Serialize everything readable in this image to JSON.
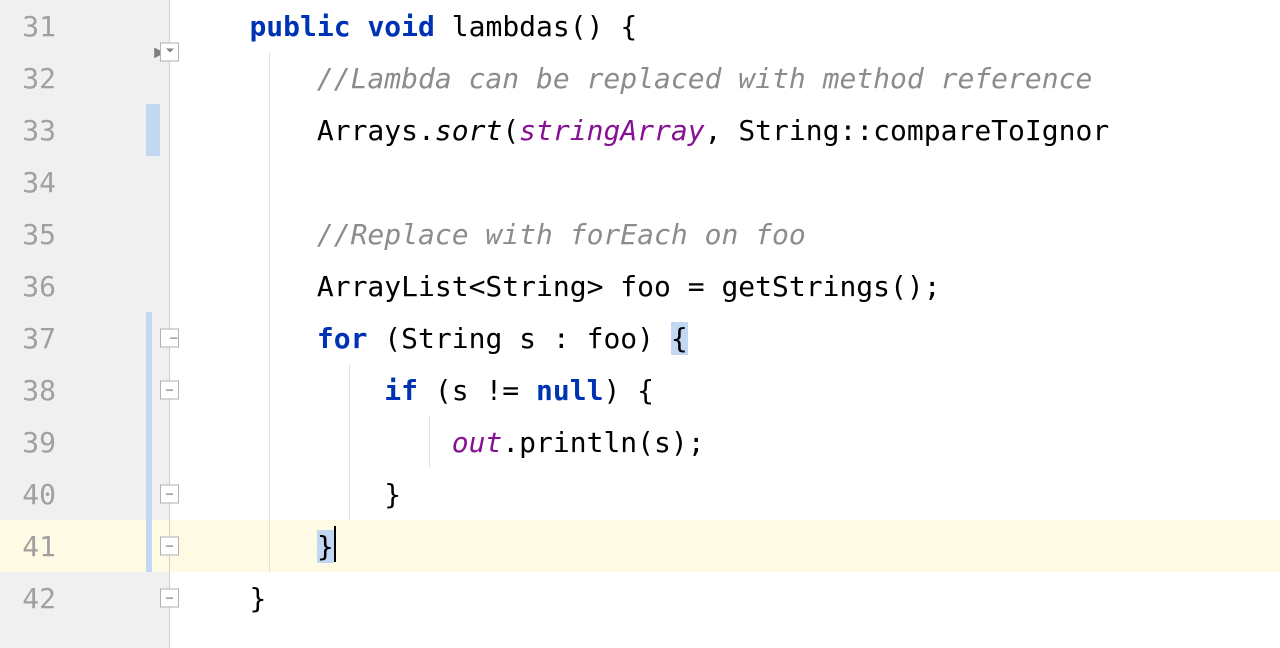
{
  "lines": {
    "start": 31,
    "end": 42,
    "numbers": [
      "31",
      "32",
      "33",
      "34",
      "35",
      "36",
      "37",
      "38",
      "39",
      "40",
      "41",
      "42"
    ]
  },
  "code": {
    "line31": {
      "indent": "    ",
      "kw1": "public",
      "kw2": "void",
      "sp": " ",
      "name": " lambdas() {"
    },
    "line32": {
      "indent": "        ",
      "comment": "//Lambda can be replaced with method reference"
    },
    "line33": {
      "indent": "        ",
      "text1": "Arrays.",
      "sort": "sort",
      "text2": "(",
      "field": "stringArray",
      "text3": ", String::compareToIgnor"
    },
    "line34": {
      "text": ""
    },
    "line35": {
      "indent": "        ",
      "comment": "//Replace with forEach on foo"
    },
    "line36": {
      "indent": "        ",
      "text": "ArrayList<String> foo = getStrings();"
    },
    "line37": {
      "indent": "        ",
      "kw": "for",
      "text1": " (String s : foo) ",
      "brace": "{"
    },
    "line38": {
      "indent": "            ",
      "kw": "if",
      "text1": " (s != ",
      "kw2": "null",
      "text2": ") {"
    },
    "line39": {
      "indent": "                ",
      "out": "out",
      "text": ".println(s);"
    },
    "line40": {
      "indent": "            ",
      "text": "}"
    },
    "line41": {
      "indent": "        ",
      "brace": "}"
    },
    "line42": {
      "indent": "    ",
      "text": "}"
    }
  }
}
